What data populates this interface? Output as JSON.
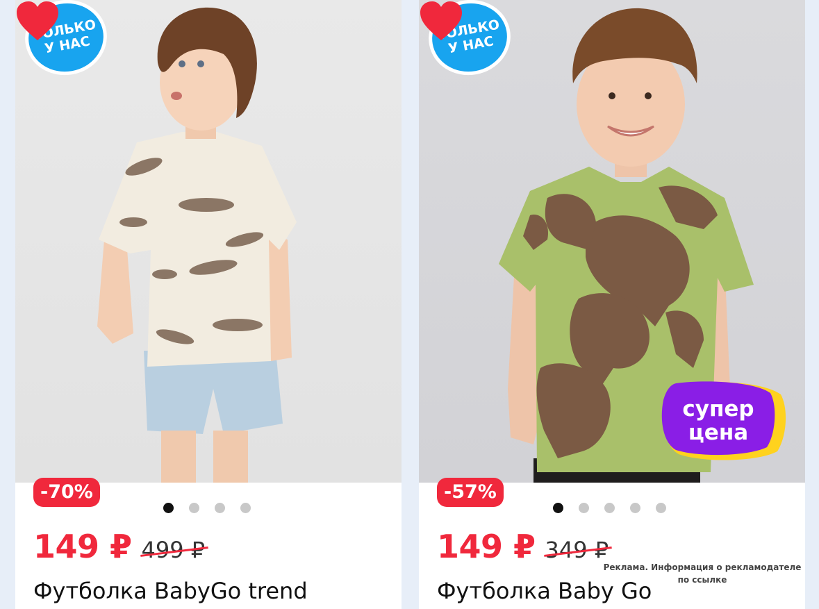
{
  "colors": {
    "accent_red": "#f0283c",
    "badge_blue": "#18a4ef",
    "super_purple": "#8a1ee6",
    "super_yellow": "#ffd21e"
  },
  "cards": [
    {
      "badge": [
        "ТОЛЬКО",
        "У НАС"
      ],
      "discount": "-70%",
      "price": "149 ₽",
      "old_price": "499 ₽",
      "title": "Футболка BabyGo trend",
      "dots_total": 4,
      "dot_active": 0,
      "favorite_icon": "heart-icon"
    },
    {
      "badge": [
        "ТОЛЬКО",
        "У НАС"
      ],
      "discount": "-57%",
      "price": "149 ₽",
      "old_price": "349 ₽",
      "title": "Футболка Baby Go",
      "dots_total": 5,
      "dot_active": 0,
      "favorite_icon": "heart-icon",
      "super_price": [
        "супер",
        "цена"
      ],
      "ad_note": "Реклама. Информация о рекламодателе по ссылке"
    }
  ]
}
